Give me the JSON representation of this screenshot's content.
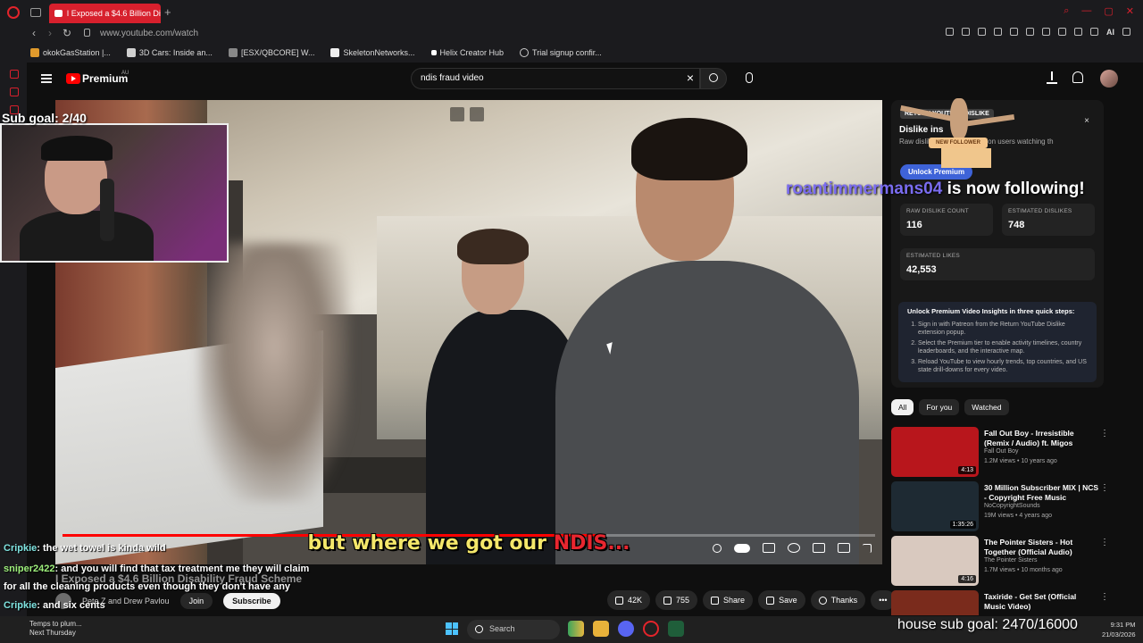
{
  "browser": {
    "tab_title": "I Exposed a $4.6 Billion Disab",
    "url": "www.youtube.com/watch",
    "ai_label": "AI",
    "bookmarks": [
      "okokGasStation |...",
      "3D Cars: Inside an...",
      "[ESX/QBCORE] W...",
      "SkeletonNetworks...",
      "Helix Creator Hub",
      "Trial signup confir..."
    ]
  },
  "youtube": {
    "brand": "Premium",
    "region": "AU",
    "search_query": "ndis fraud video",
    "video_title": "I Exposed a $4.6 Billion Disability Fraud Scheme",
    "channel": "Pete Z and Drew Pavlou",
    "join_label": "Join",
    "subscribe_label": "Subscribe",
    "likes": "42K",
    "dislikes": "755",
    "share_label": "Share",
    "save_label": "Save",
    "thanks_label": "Thanks",
    "caption_part1": "but where we got our ",
    "caption_part2": "NDIS...",
    "progress_fraction": 0.66
  },
  "rytd": {
    "badge": "RETURN YOUTUBE DISLIKE",
    "title": "Dislike ins",
    "description": "Raw dislikes ... from extension users watching th",
    "unlock_label": "Unlock Premium",
    "stats": [
      {
        "label": "RAW DISLIKE COUNT",
        "value": "116"
      },
      {
        "label": "ESTIMATED DISLIKES",
        "value": "748"
      },
      {
        "label": "ESTIMATED LIKES",
        "value": "42,553"
      }
    ],
    "steps_title": "Unlock Premium Video Insights in three quick steps:",
    "steps": [
      "Sign in with Patreon from the Return YouTube Dislike extension popup.",
      "Select the Premium tier to enable activity timelines, country leaderboards, and the interactive map.",
      "Reload YouTube to view hourly trends, top countries, and US state drill-downs for every video."
    ]
  },
  "chips": [
    "All",
    "For you",
    "Watched"
  ],
  "recommendations": [
    {
      "title": "Fall Out Boy - Irresistible (Remix / Audio) ft. Migos",
      "channel": "Fall Out Boy",
      "meta": "1.2M views • 10 years ago",
      "duration": "4:13",
      "color": "#b8161c"
    },
    {
      "title": "30 Million Subscriber MIX | NCS - Copyright Free Music",
      "channel": "NoCopyrightSounds",
      "meta": "19M views • 4 years ago",
      "duration": "1:35:26",
      "color": "#1e2a33"
    },
    {
      "title": "The Pointer Sisters - Hot Together (Official Audio)",
      "channel": "The Pointer Sisters",
      "meta": "1.7M views • 10 months ago",
      "duration": "4:16",
      "color": "#d9c9bf"
    },
    {
      "title": "Taxiride - Get Set (Official Music Video)",
      "channel": "",
      "meta": "",
      "duration": "",
      "color": "#7a2b1c"
    }
  ],
  "stream": {
    "sub_goal": "Sub goal: 2/40",
    "follower_name": "roantimmermans04",
    "follower_suffix": " is now following!",
    "alert_banner": "NEW FOLLOWER",
    "house_goal": "house sub goal: 2470/16000",
    "chat": [
      {
        "user": "Cripkie",
        "message": ": the wet towel is kinda wild"
      },
      {
        "user": "sniper2422",
        "message": ": and you will find that tax treatment me they will claim"
      },
      {
        "user": "",
        "message": "for all the cleaning products even though they don't have any"
      },
      {
        "user": "Cripkie",
        "message": ": and six cents"
      }
    ]
  },
  "taskbar": {
    "weather_line1": "Temps to plum...",
    "weather_line2": "Next Thursday",
    "search_placeholder": "Search",
    "time": "9:31 PM",
    "date": "21/03/2026"
  }
}
